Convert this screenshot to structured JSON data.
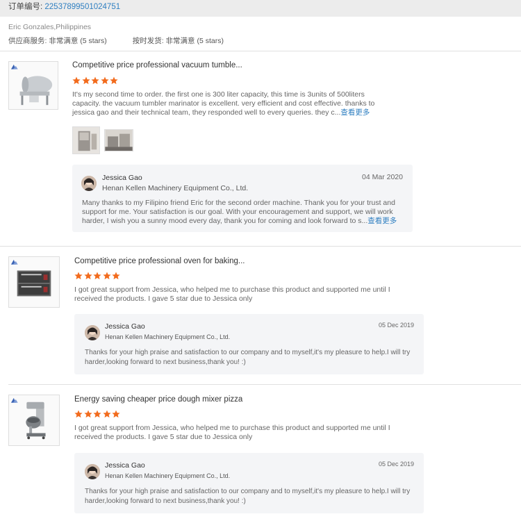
{
  "order": {
    "label": "订单编号: ",
    "number": "22537899501024751"
  },
  "buyer": {
    "name_country": "Eric Gonzales,Philippines",
    "supplier_service_label": "供应商服务: ",
    "supplier_service_value": "非常满意",
    "supplier_service_stars": "(5 stars)",
    "delivery_label": "按时发货: ",
    "delivery_value": "非常满意",
    "delivery_stars": "(5 stars)"
  },
  "reviews": [
    {
      "product_title": "Competitive price professional vacuum tumble...",
      "rating": 5,
      "text": "It's my second time to order. the first one is 300 liter capacity, this time is 3units of 500liters capacity. the vacuum tumbler marinator is excellent. very efficient and cost effective. thanks to jessica gao and their technical team, they responded well to every queries. they c...",
      "more_link": "查看更多",
      "reply": {
        "name": "Jessica Gao",
        "company": "Henan Kellen Machinery Equipment Co., Ltd.",
        "date": "04 Mar 2020",
        "text": "Many thanks to my Filipino friend Eric for the second order machine. Thank you for your trust and support for me. Your satisfaction is our goal. With your encouragement and support, we will work harder, I wish you a sunny mood every day, thank you for coming and look forward to s...",
        "more_link": "查看更多"
      }
    },
    {
      "product_title": "Competitive price professional oven for baking...",
      "rating": 5,
      "text": "I got great support from Jessica, who helped me to purchase this product and supported me until I received the products. I gave 5 star due to Jessica only",
      "reply": {
        "name": "Jessica Gao",
        "company": "Henan Kellen Machinery Equipment Co., Ltd.",
        "date": "05 Dec 2019",
        "text": "Thanks for your high praise and satisfaction to our company and to myself,it's my pleasure to help.I will try harder,looking forward to next business,thank you! :)"
      }
    },
    {
      "product_title": "Energy saving cheaper price dough mixer pizza",
      "rating": 5,
      "text": "I got great support from Jessica, who helped me to purchase this product and supported me until I received the products. I gave 5 star due to Jessica only",
      "reply": {
        "name": "Jessica Gao",
        "company": "Henan Kellen Machinery Equipment Co., Ltd.",
        "date": "05 Dec 2019",
        "text": "Thanks for your high praise and satisfaction to our company and to myself,it's my pleasure to help.I will try harder,looking forward to next business,thank you! :)"
      }
    }
  ],
  "colors": {
    "star": "#f26b1d",
    "link": "#2f7fc1",
    "reply_bg": "#f4f5f7"
  },
  "icons": [
    "star-icon",
    "logo-icon",
    "avatar-icon"
  ]
}
